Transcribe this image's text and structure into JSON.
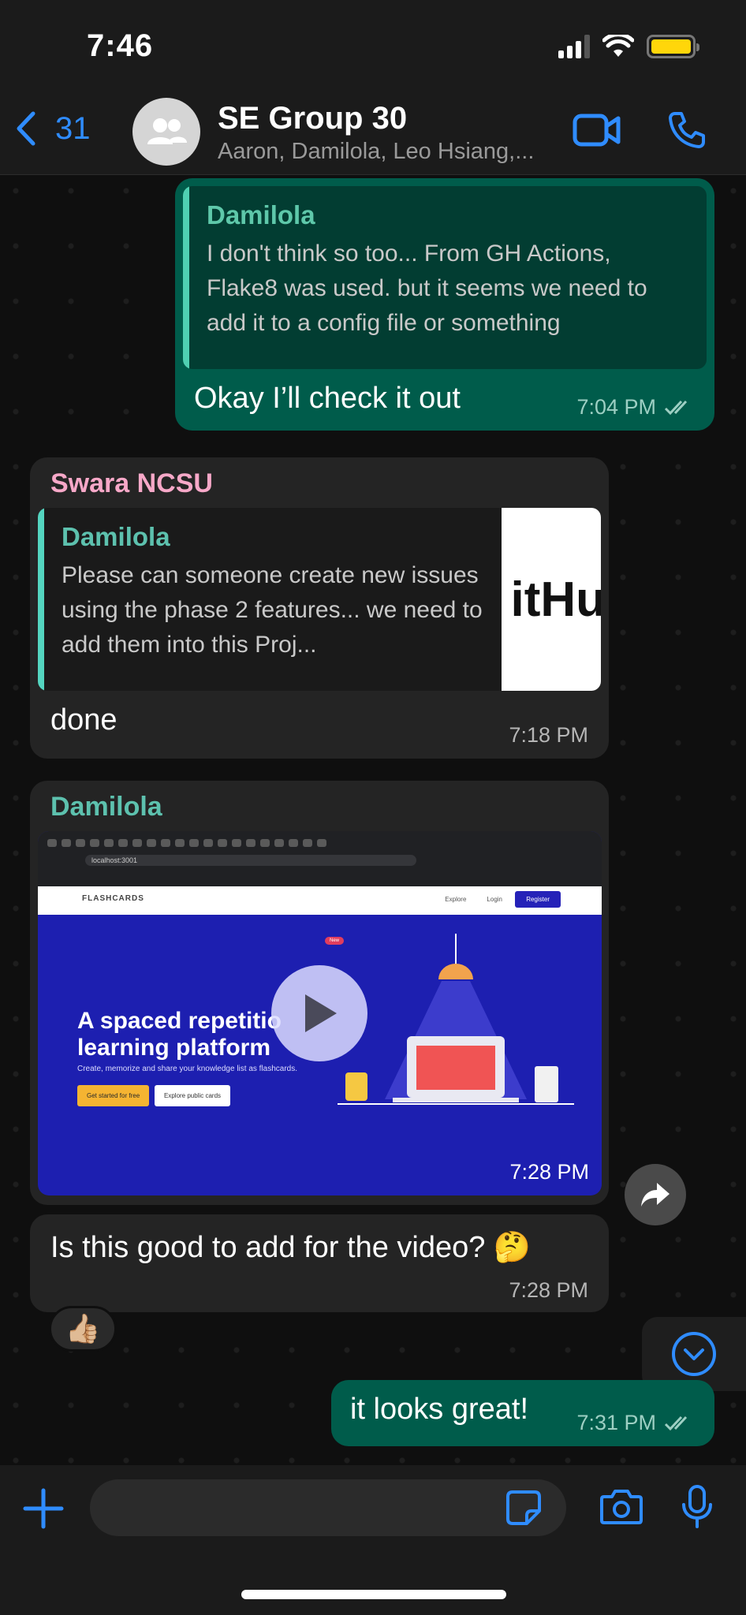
{
  "status_bar": {
    "time": "7:46"
  },
  "header": {
    "back_count": "31",
    "title": "SE Group 30",
    "subtitle": "Aaron, Damilola, Leo Hsiang,..."
  },
  "messages": {
    "m1": {
      "quote_author": "Damilola",
      "quote_text": "I don't think so too... From GH Actions, Flake8 was used. but it seems we need to add it to a config file or something",
      "text": "Okay I’ll check it out",
      "time": "7:04 PM"
    },
    "m2": {
      "sender": "Swara NCSU",
      "quote_author": "Damilola",
      "quote_text": "Please can someone create new issues using the phase 2 features... we need to add them into this Proj...",
      "quote_thumb_text": "itHu",
      "text": "done",
      "time": "7:18 PM"
    },
    "m3": {
      "sender": "Damilola",
      "video": {
        "url_text": "localhost:3001",
        "site_logo": "FLASHCARDS",
        "nav": [
          "Explore",
          "Login"
        ],
        "register": "Register",
        "badge": "New",
        "hero_title_line1": "A spaced repetitio",
        "hero_title_line2": "learning platform",
        "hero_sub": "Create, memorize and share your knowledge list as flashcards.",
        "btn_start": "Get started for free",
        "btn_explore": "Explore public cards",
        "time": "7:28 PM"
      }
    },
    "m4": {
      "text": "Is this good to add for the video? 🤔",
      "time": "7:28 PM",
      "reaction": "👍🏼"
    },
    "m5": {
      "text": "it looks great!",
      "time": "7:31 PM"
    }
  },
  "colors": {
    "accent": "#2f8cff",
    "outgoing_bubble": "#005c4b",
    "incoming_bubble": "#242424",
    "sender_swara": "#f7a8c8",
    "sender_damilola": "#5dc1ae"
  }
}
